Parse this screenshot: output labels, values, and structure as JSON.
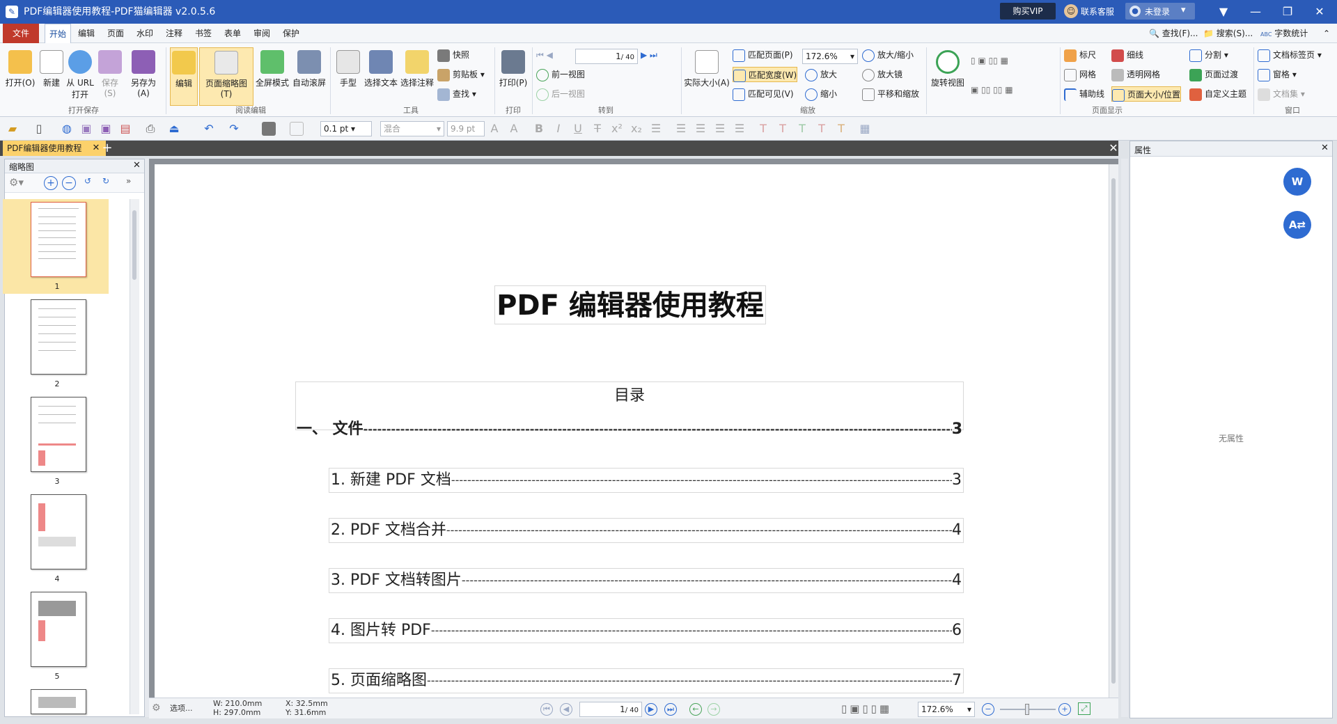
{
  "window": {
    "title": "PDF编辑器使用教程-PDF猫编辑器 v2.0.5.6",
    "buy_vip": "购买VIP",
    "service": "联系客服",
    "login": "未登录"
  },
  "menu": {
    "items": [
      "文件",
      "开始",
      "编辑",
      "页面",
      "水印",
      "注释",
      "书签",
      "表单",
      "审阅",
      "保护"
    ],
    "right": {
      "find": "查找(F)...",
      "search": "搜索(S)...",
      "word_count": "字数统计",
      "abc": "ABC\n123"
    }
  },
  "ribbon": {
    "open": "打开(O)",
    "new": "新建",
    "from_url": "从 URL\n打开",
    "save": "保存(S)",
    "save_as": "另存为(A)",
    "group_open_save": "打开保存",
    "edit": "编辑",
    "thumb": "页面缩略图(T)",
    "fullscreen": "全屏模式",
    "autoscroll": "自动滚屏",
    "group_read_edit": "阅读编辑",
    "hand": "手型",
    "select_text": "选择文本",
    "select_annot": "选择注释",
    "snapshot": "快照",
    "clipboard": "剪贴板",
    "find": "查找",
    "group_tools": "工具",
    "print": "打印(P)",
    "group_print": "打印",
    "page_input": "1",
    "page_total": "/ 40",
    "prev_view": "前一视图",
    "next_view": "后一视图",
    "group_goto": "转到",
    "actual_size": "实际大小(A)",
    "fit_page": "匹配页面(P)",
    "fit_width": "匹配宽度(W)",
    "fit_visible": "匹配可见(V)",
    "zoom_value": "172.6%",
    "zoom_in_out": "放大/缩小",
    "zoom_in": "放大",
    "zoom_out": "缩小",
    "magnifier": "放大镜",
    "pan_zoom": "平移和缩放",
    "group_zoom": "缩放",
    "rotate": "旋转视图",
    "ruler": "标尺",
    "thin_line": "细线",
    "grid": "网格",
    "trans_grid": "透明网格",
    "guide": "辅助线",
    "page_size_pos": "页面大小/位置",
    "split": "分割",
    "page_transition": "页面过渡",
    "custom_theme": "自定义主题",
    "group_page_display": "页面显示",
    "doc_tabs": "文档标签页",
    "pane": "窗格",
    "doc_set": "文档集",
    "group_window": "窗口"
  },
  "toolbar2": {
    "line_width": "0.1 pt",
    "font": "混合",
    "font_size": "9.9 pt"
  },
  "tab": {
    "doc_name": "PDF编辑器使用教程"
  },
  "thumbs": {
    "title": "缩略图",
    "pages": [
      "1",
      "2",
      "3",
      "4",
      "5"
    ]
  },
  "document": {
    "title": "PDF 编辑器使用教程",
    "toc_heading": "目录",
    "toc": [
      {
        "label": "一、  文件",
        "page": "3",
        "bold": true
      },
      {
        "label": "1.  新建 PDF 文档",
        "page": "3"
      },
      {
        "label": "2. PDF 文档合并",
        "page": "4"
      },
      {
        "label": "3. PDF 文档转图片",
        "page": "4"
      },
      {
        "label": "4.  图片转 PDF",
        "page": "6"
      },
      {
        "label": "5.  页面缩略图",
        "page": "7"
      }
    ]
  },
  "status": {
    "options": "选项...",
    "width": "W: 210.0mm",
    "height": "H: 297.0mm",
    "x": "X:   32.5mm",
    "y": "Y:   31.6mm",
    "page_input": "1",
    "page_total": "/ 40",
    "zoom": "172.6%"
  },
  "properties": {
    "title": "属性",
    "empty": "无属性"
  }
}
